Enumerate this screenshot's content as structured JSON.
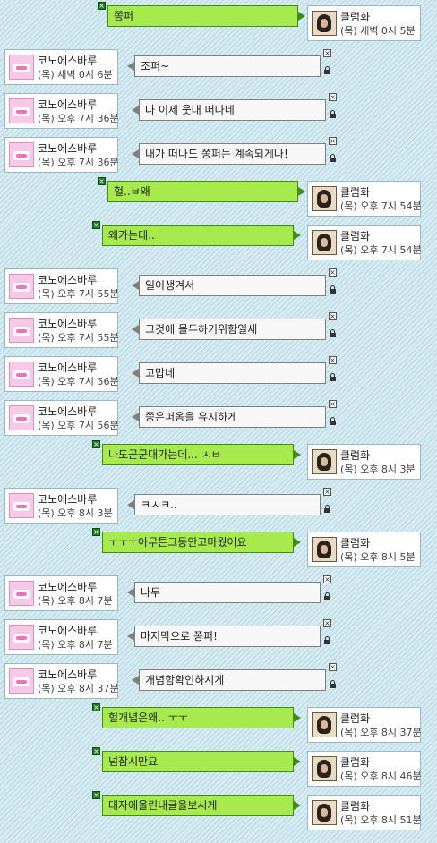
{
  "users": {
    "left": {
      "name": "코노에스바루"
    },
    "right": {
      "name": "클럼화"
    }
  },
  "messages": [
    {
      "side": "right",
      "text": "쫑퍼",
      "time": "(목) 새벽 0시 5분"
    },
    {
      "side": "left",
      "text": "조퍼~",
      "time": "(목) 새벽 0시 6분"
    },
    {
      "side": "left",
      "text": "나 이제 웃대 떠나네",
      "time": "(목) 오후 7시 36분"
    },
    {
      "side": "left",
      "text": "내가 떠나도 쫑퍼는 계속되게나!",
      "time": "(목) 오후 7시 36분"
    },
    {
      "side": "right",
      "text": "헐..ㅂ왜",
      "time": "(목) 오후 7시 54분"
    },
    {
      "side": "right",
      "text": "왜가는데..",
      "time": "(목) 오후 7시 54분"
    },
    {
      "side": "left",
      "text": "일이생겨서",
      "time": "(목) 오후 7시 55분"
    },
    {
      "side": "left",
      "text": "그것에 몰두하기위함일세",
      "time": "(목) 오후 7시 55분"
    },
    {
      "side": "left",
      "text": "고맙네",
      "time": "(목) 오후 7시 56분"
    },
    {
      "side": "left",
      "text": "쫑은퍼옴을 유지하게",
      "time": "(목) 오후 7시 56분"
    },
    {
      "side": "right",
      "text": "나도곧군대가는데... ㅅㅂ",
      "time": "(목) 오후 8시 3분"
    },
    {
      "side": "left",
      "text": "ㅋㅅㅋ..",
      "time": "(목) 오후 8시 3분"
    },
    {
      "side": "right",
      "text": "ㅜㅜㅜ아무튼그동안고마웠어요",
      "time": "(목) 오후 8시 5분"
    },
    {
      "side": "left",
      "text": "나두",
      "time": "(목) 오후 8시 7분"
    },
    {
      "side": "left",
      "text": "마지막으로 쫑퍼!",
      "time": "(목) 오후 8시 7분"
    },
    {
      "side": "left",
      "text": "개념함확인하시게",
      "time": "(목) 오후 8시 37분"
    },
    {
      "side": "right",
      "text": "헐개념은왜.. ㅜㅜ",
      "time": "(목) 오후 8시 37분"
    },
    {
      "side": "right",
      "text": "넘잠시만요",
      "time": "(목) 오후 8시 46분"
    },
    {
      "side": "right",
      "text": "대자에올린내글을보시게",
      "time": "(목) 오후 8시 51분"
    }
  ],
  "icons": {
    "delete": "close-icon",
    "lock": "lock-icon",
    "left_avatar": "pink-logo-avatar",
    "right_avatar": "portrait-avatar"
  },
  "colors": {
    "right_bubble": "#a6ea4e",
    "left_bubble": "#f7f7f7",
    "background": "#cfe6ee"
  }
}
